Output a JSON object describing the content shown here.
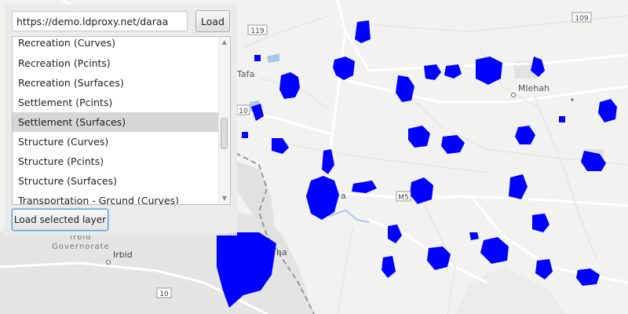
{
  "app": {
    "url_value": "https://demo.ldproxy.net/daraa",
    "load_label": "Load",
    "load_layer_label": "Load selected layer"
  },
  "layers": [
    {
      "label": "Recreation (Curves)"
    },
    {
      "label": "Recreation (Pcints)"
    },
    {
      "label": "Recreation (Surfaces)"
    },
    {
      "label": "Settlement (Pcints)"
    },
    {
      "label": "Settlement (Surfaces)",
      "selected": true
    },
    {
      "label": "Structure (Curves)"
    },
    {
      "label": "Structure (Pcints)"
    },
    {
      "label": "Structure (Surfaces)"
    },
    {
      "label": "Transportation - Grcund (Curves)"
    }
  ],
  "map": {
    "labels": {
      "tafas": "Tafa",
      "mlehah": "Mlehah",
      "irbid": "Irbid",
      "irbid_governorate_1": "Irbid",
      "irbid_governorate_2": "Governorate",
      "daraa_partial": "a",
      "ha_partial": "ha"
    },
    "road_shields": {
      "r119": "119",
      "r109": "109",
      "r10": "10",
      "m5": "M5",
      "r110_partial": "10"
    },
    "colors": {
      "feature": "#0000ff",
      "road": "#ffffff",
      "border": "#9a9a9a",
      "water": "#a8c8e8",
      "background": "#f2f2f1"
    }
  }
}
